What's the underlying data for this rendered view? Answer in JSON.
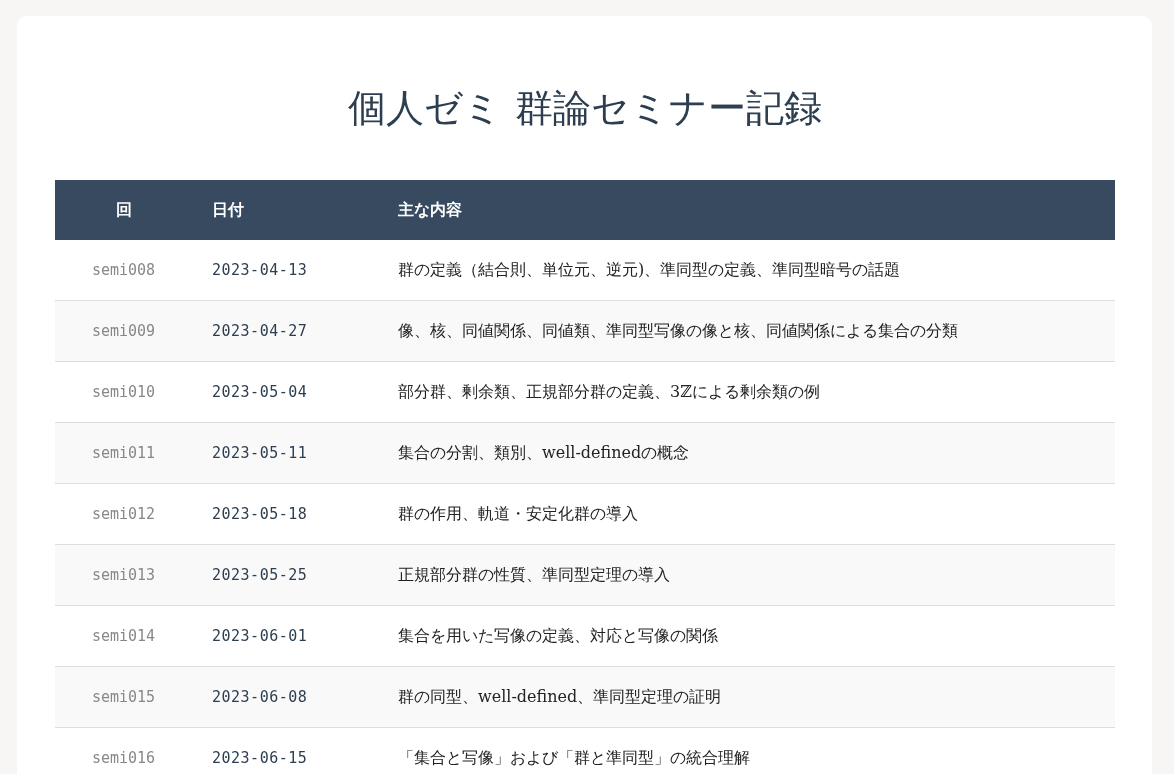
{
  "title": "個人ゼミ 群論セミナー記録",
  "table": {
    "columns": [
      "回",
      "日付",
      "主な内容"
    ],
    "rows": [
      {
        "session": "semi008",
        "date": "2023-04-13",
        "content": "群の定義（結合則、単位元、逆元)、準同型の定義、準同型暗号の話題"
      },
      {
        "session": "semi009",
        "date": "2023-04-27",
        "content": "像、核、同値関係、同値類、準同型写像の像と核、同値関係による集合の分類"
      },
      {
        "session": "semi010",
        "date": "2023-05-04",
        "content": "部分群、剰余類、正規部分群の定義、3ℤによる剰余類の例"
      },
      {
        "session": "semi011",
        "date": "2023-05-11",
        "content": "集合の分割、類別、well-definedの概念"
      },
      {
        "session": "semi012",
        "date": "2023-05-18",
        "content": "群の作用、軌道・安定化群の導入"
      },
      {
        "session": "semi013",
        "date": "2023-05-25",
        "content": "正規部分群の性質、準同型定理の導入"
      },
      {
        "session": "semi014",
        "date": "2023-06-01",
        "content": "集合を用いた写像の定義、対応と写像の関係"
      },
      {
        "session": "semi015",
        "date": "2023-06-08",
        "content": "群の同型、well-defined、準同型定理の証明"
      },
      {
        "session": "semi016",
        "date": "2023-06-15",
        "content": "「集合と写像」および「群と準同型」の統合理解"
      }
    ]
  }
}
